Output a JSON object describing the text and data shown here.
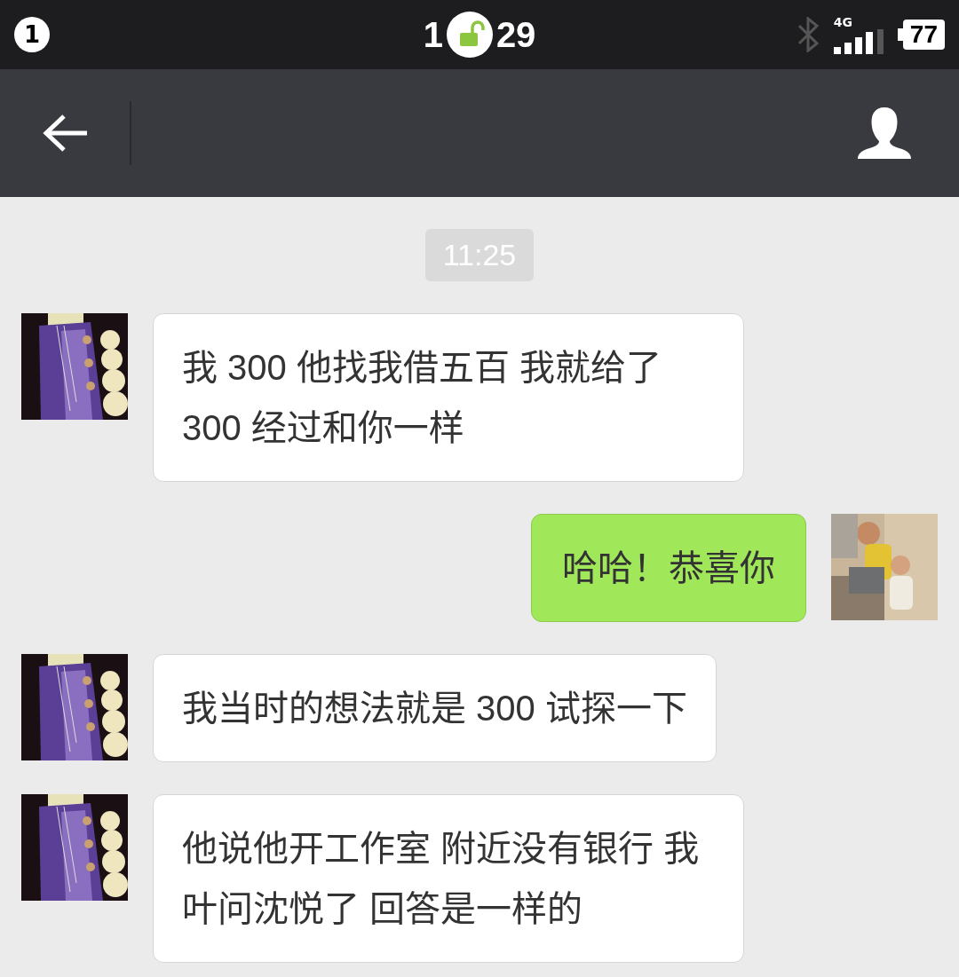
{
  "status_bar": {
    "notification_count": "1",
    "time_parts": [
      "1",
      "29"
    ],
    "network": "4G",
    "battery": "77"
  },
  "chat": {
    "timestamp": "11:25",
    "messages": [
      {
        "kind": "incoming",
        "text": "我 300 他找我借五百 我就给了300 经过和你一样"
      },
      {
        "kind": "outgoing",
        "text": "哈哈！恭喜你"
      },
      {
        "kind": "incoming",
        "text": "我当时的想法就是 300 试探一下"
      },
      {
        "kind": "incoming",
        "text": "他说他开工作室 附近没有银行 我叶问沈悦了 回答是一样的"
      }
    ]
  }
}
